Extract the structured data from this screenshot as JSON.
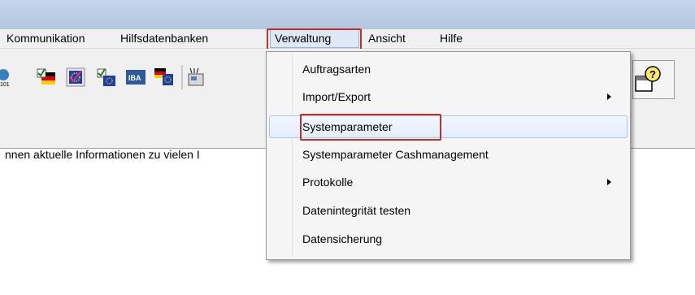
{
  "menubar": {
    "items": [
      {
        "label": "Kommunikation"
      },
      {
        "label": "Hilfsdatenbanken"
      },
      {
        "label": "Verwaltung"
      },
      {
        "label": "Ansicht"
      },
      {
        "label": "Hilfe"
      }
    ]
  },
  "toolbar": {
    "icons": [
      "globe-icon",
      "flag-checklist-icon",
      "eu-checklist-icon",
      "flag-checklist-icon",
      "iba-icon",
      "flag-eu-icon",
      "phone-icon"
    ],
    "help_icon": "help-window-icon",
    "icon_text": {
      "small_number": "101",
      "iba": "IBA"
    }
  },
  "content": {
    "text": "nnen aktuelle Informationen zu vielen I"
  },
  "dropdown": {
    "items": [
      {
        "label": "Auftragsarten",
        "submenu": false
      },
      {
        "label": "Import/Export",
        "submenu": true
      },
      {
        "label": "Systemparameter",
        "submenu": false,
        "hovered": true
      },
      {
        "label": "Systemparameter Cashmanagement",
        "submenu": false
      },
      {
        "label": "Protokolle",
        "submenu": true
      },
      {
        "label": "Datenintegrität testen",
        "submenu": false
      },
      {
        "label": "Datensicherung",
        "submenu": false
      }
    ]
  },
  "colors": {
    "highlight_box": "#c0302b",
    "menubar_bg": "#f0f0f0",
    "titlebar": "#b3c7e0"
  }
}
